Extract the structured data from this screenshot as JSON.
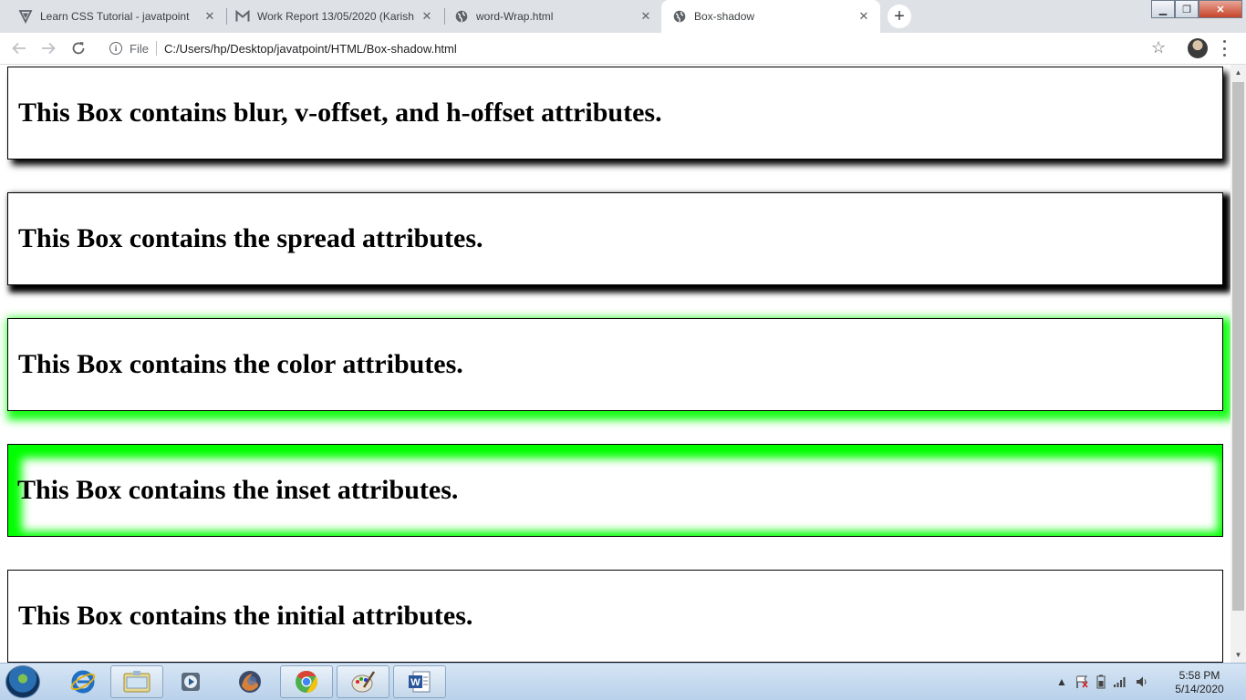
{
  "browser": {
    "tabs": [
      {
        "title": "Learn CSS Tutorial - javatpoint",
        "icon": "javatpoint-icon",
        "active": false
      },
      {
        "title": "Work Report 13/05/2020 (Karishma",
        "icon": "gmail-icon",
        "active": false
      },
      {
        "title": "word-Wrap.html",
        "icon": "globe-icon",
        "active": false
      },
      {
        "title": "Box-shadow",
        "icon": "globe-icon",
        "active": true
      }
    ],
    "new_tab_label": "+",
    "address": {
      "security_label": "File",
      "url": "C:/Users/hp/Desktop/javatpoint/HTML/Box-shadow.html"
    }
  },
  "page": {
    "boxes": [
      {
        "heading": "This Box contains blur, v-offset, and h-offset attributes."
      },
      {
        "heading": "This Box contains the spread attributes."
      },
      {
        "heading": "This Box contains the color attributes."
      },
      {
        "heading": "This Box contains the inset attributes."
      },
      {
        "heading": "This Box contains the initial attributes."
      }
    ],
    "shadow_color": "#00ff00"
  },
  "taskbar": {
    "apps": [
      "internet-explorer-icon",
      "file-explorer-icon",
      "media-player-icon",
      "firefox-icon",
      "chrome-icon",
      "paint-icon",
      "word-icon"
    ],
    "clock": {
      "time": "5:58 PM",
      "date": "5/14/2020"
    }
  }
}
